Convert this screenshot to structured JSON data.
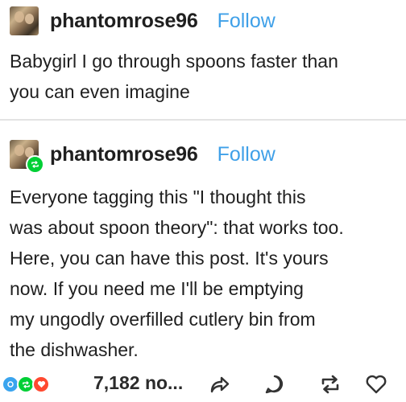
{
  "posts": [
    {
      "username": "phantomrose96",
      "follow_label": "Follow",
      "is_reblog": false,
      "body": "Babygirl I go through spoons faster than\nyou can even imagine"
    },
    {
      "username": "phantomrose96",
      "follow_label": "Follow",
      "is_reblog": true,
      "body": "Everyone tagging this \"I thought this\nwas about spoon theory\": that works too.\nHere, you can have this post. It's yours\nnow. If you need me I'll be emptying\nmy ungodly overfilled cutlery bin from\nthe dishwasher."
    }
  ],
  "footer": {
    "notes_label": "7,182 no...",
    "actions": [
      "share-icon",
      "reply-icon",
      "reblog-icon",
      "heart-icon"
    ]
  },
  "colors": {
    "follow": "#3fa0e8",
    "reblog_green": "#00cf35",
    "like_red": "#ff4930",
    "reply_blue": "#3aa4ee"
  }
}
